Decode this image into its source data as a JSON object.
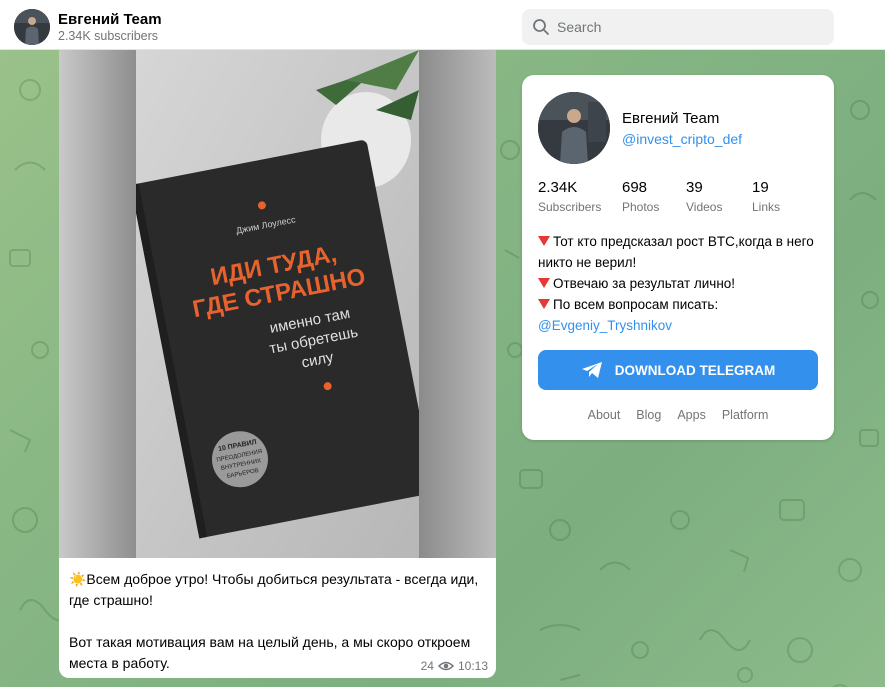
{
  "header": {
    "channel_title": "Евгений Team",
    "subscribers_line": "2.34K subscribers",
    "search_placeholder": "Search",
    "avatar_icon": "channel-avatar"
  },
  "post": {
    "photo_text": {
      "author": "Джим Лоулесс",
      "title_line1": "ИДИ ТУДА,",
      "title_line2": "ГДЕ СТРАШНО",
      "subtitle_line1": "именно там",
      "subtitle_line2": "ты обретешь",
      "subtitle_line3": "силу",
      "badge_line1": "10 ПРАВИЛ",
      "badge_line2": "ПРЕОДОЛЕНИЯ",
      "badge_line3": "ВНУТРЕННИХ",
      "badge_line4": "БАРЬЕРОВ"
    },
    "text_line1": "☀️Всем доброе утро! Чтобы добиться результата - всегда иди, где страшно!",
    "text_line2": "Вот такая мотивация вам на целый день, а мы скоро откроем места в работу.",
    "views": "24",
    "time": "10:13"
  },
  "card": {
    "title": "Евгений Team",
    "handle": "@invest_cripto_def",
    "stats": [
      {
        "value": "2.34K",
        "label": "Subscribers"
      },
      {
        "value": "698",
        "label": "Photos"
      },
      {
        "value": "39",
        "label": "Videos"
      },
      {
        "value": "19",
        "label": "Links"
      }
    ],
    "bio": {
      "line1": "Тот кто предсказал рост BTC,когда в него никто не верил!",
      "line2": "Отвечаю за результат лично!",
      "line3": "По всем вопросам писать:",
      "link": "@Evgeniy_Tryshnikov"
    },
    "download_label": "DOWNLOAD TELEGRAM",
    "footer_links": [
      "About",
      "Blog",
      "Apps",
      "Platform"
    ]
  },
  "colors": {
    "accent": "#3390ec",
    "background_green": "#88b784",
    "marker_red": "#e53935",
    "book_orange": "#e8622e"
  }
}
